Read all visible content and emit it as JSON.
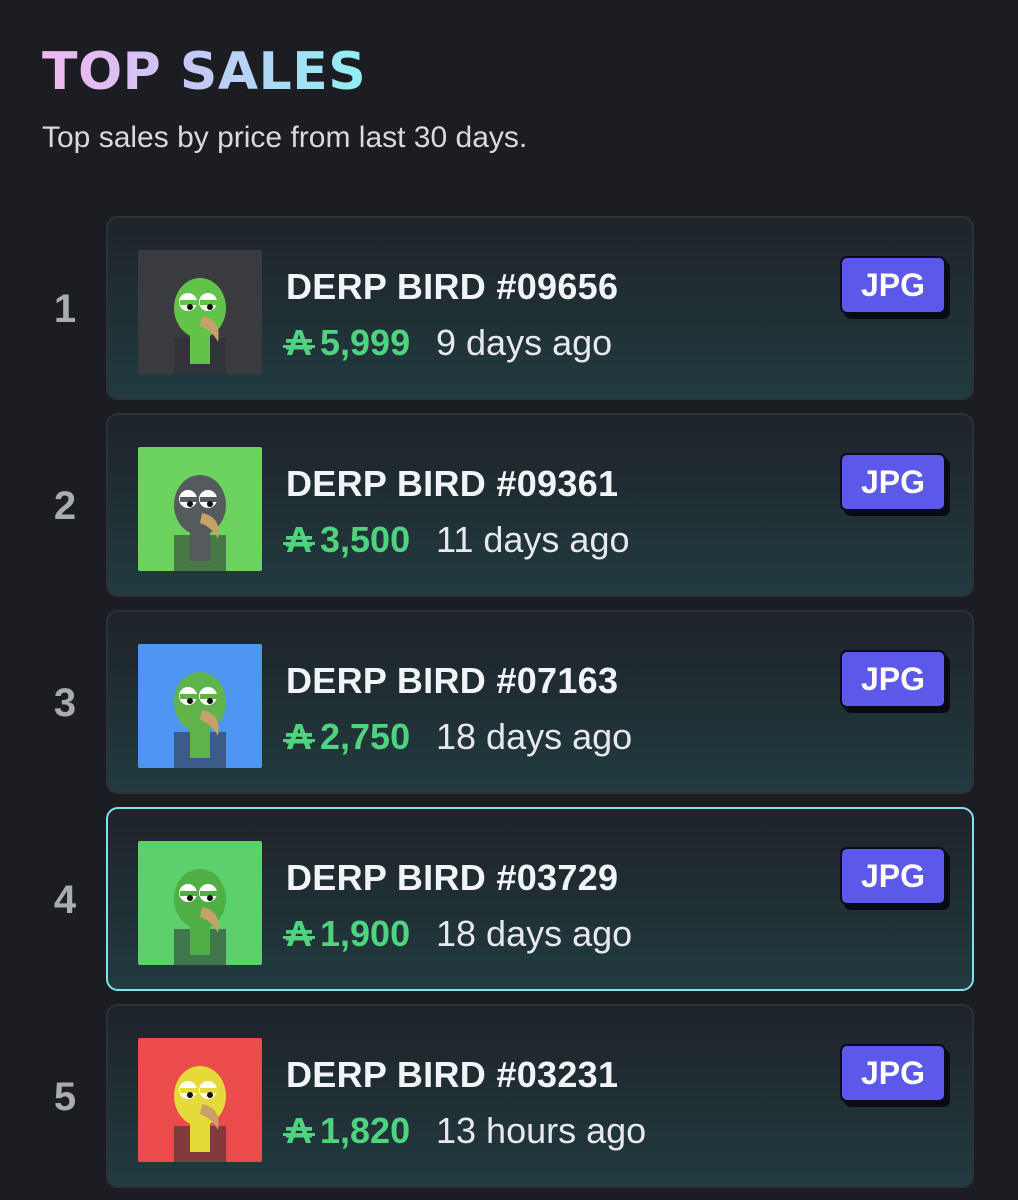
{
  "header": {
    "title": "TOP SALES",
    "subtitle": "Top sales by price from last 30 days."
  },
  "currency_symbol": "₳",
  "accent_colors": {
    "price": "#4fd37f",
    "badge": "#5b58ea",
    "selected_border": "#7fe3ee"
  },
  "sales": [
    {
      "rank": "1",
      "name": "DERP BIRD #09656",
      "price": "5,999",
      "time": "9 days ago",
      "badge": "JPG",
      "thumb_bg": "#3a3b3e",
      "bird_color": "#63c24a"
    },
    {
      "rank": "2",
      "name": "DERP BIRD #09361",
      "price": "3,500",
      "time": "11 days ago",
      "badge": "JPG",
      "thumb_bg": "#6cd35e",
      "bird_color": "#555a5f"
    },
    {
      "rank": "3",
      "name": "DERP BIRD #07163",
      "price": "2,750",
      "time": "18 days ago",
      "badge": "JPG",
      "thumb_bg": "#4f95f2",
      "bird_color": "#5fb34a"
    },
    {
      "rank": "4",
      "name": "DERP BIRD #03729",
      "price": "1,900",
      "time": "18 days ago",
      "badge": "JPG",
      "thumb_bg": "#5cd06a",
      "bird_color": "#4fae44",
      "selected": true
    },
    {
      "rank": "5",
      "name": "DERP BIRD #03231",
      "price": "1,820",
      "time": "13 hours ago",
      "badge": "JPG",
      "thumb_bg": "#ec4b4b",
      "bird_color": "#e6d93a"
    }
  ]
}
